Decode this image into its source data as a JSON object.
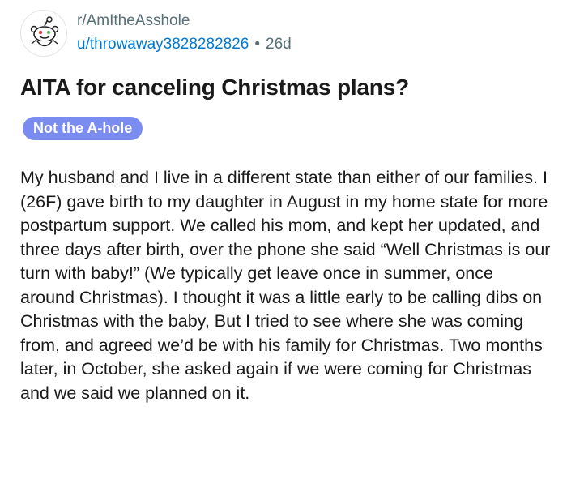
{
  "post": {
    "subreddit": "r/AmItheAsshole",
    "author": "u/throwaway3828282826",
    "separator": "•",
    "age": "26d",
    "avatar_icon": "snoo-icon",
    "title": "AITA for canceling Christmas plans?",
    "flair": "Not the A-hole",
    "body": "My husband and I live in a different state than either of our families. I (26F) gave birth to my daughter in August in my home state for more postpartum support. We called his mom, and kept her updated, and three days after birth, over the phone she said “Well Christmas is our turn with baby!” (We typically get leave once in summer, once around Christmas). I thought it was a little early to be calling dibs on Christmas with the baby, But I tried to see where she was coming from, and agreed we’d be with his family for Christmas. Two months later, in October, she asked again if we were coming for Christmas and we said we planned on it."
  },
  "colors": {
    "author": "#0079d3",
    "meta": "#576f76",
    "flair_bg": "#7a8cf0",
    "flair_text": "#ffffff"
  }
}
